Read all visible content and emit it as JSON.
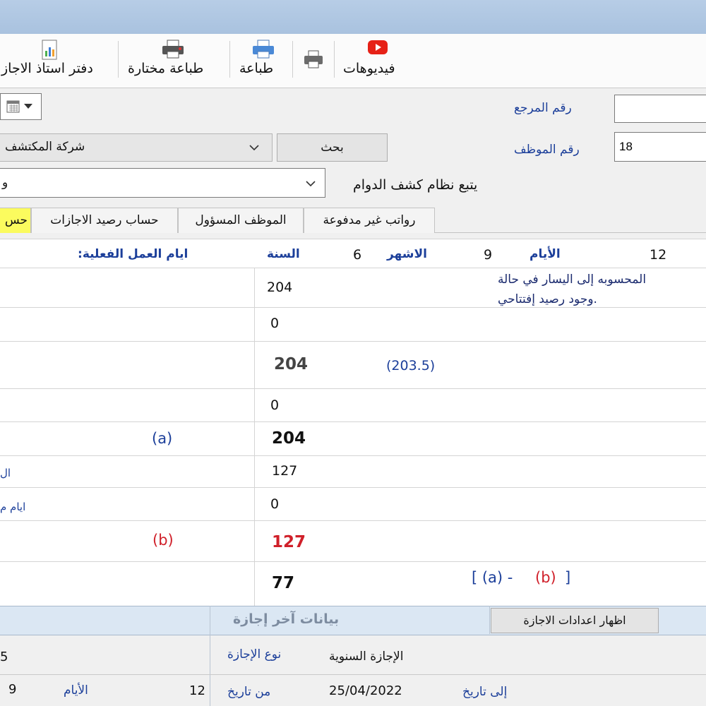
{
  "toolbar": {
    "videos_label": "فيديوهات",
    "print_label": "طباعة",
    "print_selected_label": "طباعة مختارة",
    "vacation_ledger_label": "دفتر استاذ الاجاز"
  },
  "form": {
    "reference_label": "رقم المرجع",
    "reference_value": "",
    "employee_label": "رقم الموظف",
    "employee_value": "18",
    "search_button": "بحث",
    "company_value": "شركة المكتشف",
    "attendance_label": "يتبع نظام كشف الدوام",
    "attendance_value": "و"
  },
  "tabs": [
    {
      "label": "رواتب غير مدفوعة"
    },
    {
      "label": "الموظف المسؤول"
    },
    {
      "label": "حساب رصيد الاجازات"
    },
    {
      "label": "حس"
    }
  ],
  "grid": {
    "header": {
      "days_label": "الأيام",
      "days_value": "12",
      "months_label": "الاشهر",
      "months_value": "9",
      "years_label": "السنة",
      "years_value": "6",
      "actual_work_days_label": ":ايام العمل الفعلية"
    },
    "note_line1": "المحسوبه إلى اليسار في حالة",
    "note_line2": "وجود رصيد إفتتاحي.",
    "rows": [
      {
        "value": "204"
      },
      {
        "value": "0"
      },
      {
        "value": "204",
        "extra": "(203.5)"
      },
      {
        "value": "0"
      },
      {
        "value": "204",
        "tag": "(a)"
      },
      {
        "value": "127",
        "left_label": "ال"
      },
      {
        "value": "0",
        "left_label": "ايام م"
      },
      {
        "value": "127",
        "tag": "(b)"
      },
      {
        "value": "77",
        "formula_open": "[ (a) -",
        "formula_b": "(b)",
        "formula_close": "]"
      }
    ]
  },
  "bottom": {
    "show_settings_button": "اظهار اعدادات الاجازة",
    "last_vacation_title": "بيانات آخر إجازة",
    "vacation_type_label": "نوع الإجازة",
    "vacation_type_value": "الإجازة السنوية",
    "left_value_1": "5",
    "from_date_label": "من تاريخ",
    "from_date_value": "25/04/2022",
    "to_date_label": "إلى تاريخ",
    "days_label": "الأيام",
    "days_value_a": "12",
    "days_value_b": "9"
  },
  "colors": {
    "accent_blue": "#1c3f9a",
    "alert_red": "#d0202a",
    "active_tab": "#fbfb5e",
    "youtube_red": "#e62117"
  }
}
